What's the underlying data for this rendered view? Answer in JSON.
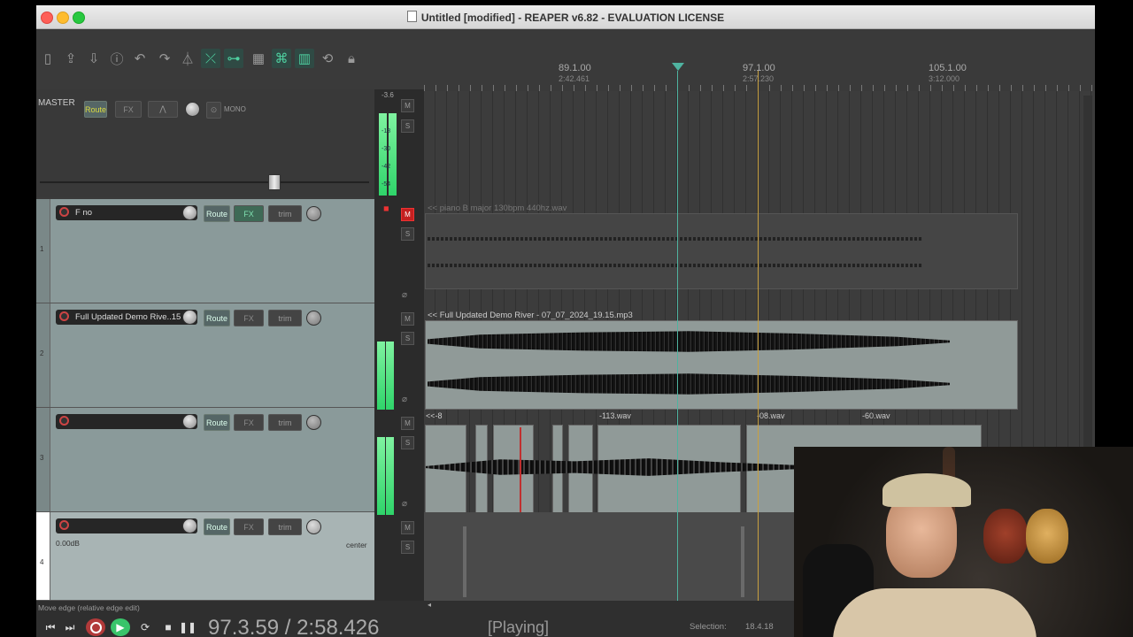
{
  "window": {
    "title": "Untitled [modified] - REAPER v6.82 - EVALUATION LICENSE"
  },
  "toolbar": {
    "icons": [
      "new-file-icon",
      "open-icon",
      "save-icon",
      "info-icon",
      "undo-icon",
      "redo-icon",
      "metronome-icon",
      "ripple-icon",
      "link-icon",
      "grid-icon",
      "envelope-link-icon",
      "snap-icon",
      "loop-icon",
      "lock-icon"
    ]
  },
  "master": {
    "label": "MASTER",
    "route": "Route",
    "fx": "FX",
    "mono": "MONO",
    "peak": "-3.6",
    "scale": [
      "-18",
      "-30",
      "-42",
      "-54"
    ]
  },
  "tracks": [
    {
      "number": "1",
      "name": "F no",
      "route": "Route",
      "fx": "FX",
      "trim": "trim",
      "vol": "",
      "pan": ""
    },
    {
      "number": "2",
      "name": "Full Updated Demo Rive..15",
      "route": "Route",
      "fx": "FX",
      "trim": "trim",
      "vol": "",
      "pan": ""
    },
    {
      "number": "3",
      "name": "",
      "route": "Route",
      "fx": "FX",
      "trim": "trim",
      "vol": "",
      "pan": ""
    },
    {
      "number": "4",
      "name": "",
      "route": "Route",
      "fx": "FX",
      "trim": "trim",
      "vol": "0.00dB",
      "pan": "center"
    }
  ],
  "ms": {
    "mute": "M",
    "solo": "S"
  },
  "ruler": {
    "marks": [
      {
        "bar": "89.1.00",
        "time": "2:42.461"
      },
      {
        "bar": "97.1.00",
        "time": "2:57.230"
      },
      {
        "bar": "105.1.00",
        "time": "3:12.000"
      }
    ]
  },
  "items": {
    "track1": "<< piano B major 130bpm 440hz.wav",
    "track2": "<< Full Updated Demo River - 07_07_2024_19.15.mp3",
    "track3": [
      "<<-8",
      "-113.wav",
      "-08.wav",
      "-60.wav"
    ]
  },
  "status": {
    "hint": "Move edge (relative edge edit)",
    "position": "97.3.59 / 2:58.426",
    "state": "[Playing]",
    "selection_label": "Selection:",
    "selection_value": "18.4.18"
  },
  "colors": {
    "accent": "#4fd0a0",
    "meter": "#2fd46a",
    "mute": "#c42020",
    "playhead": "#4fb3a0",
    "edit_cursor": "#c8a040"
  }
}
